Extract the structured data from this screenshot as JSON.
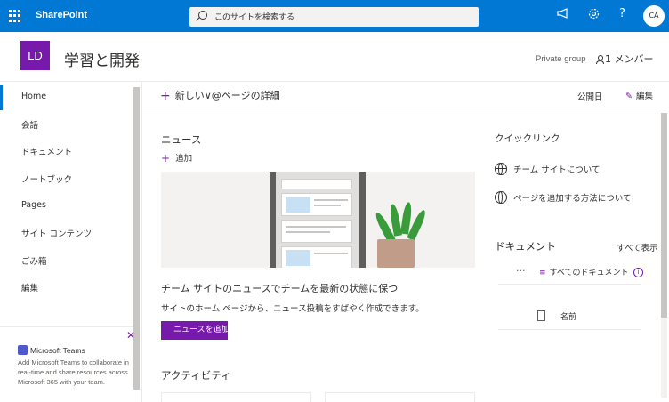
{
  "suitebar": {
    "brand": "SharePoint",
    "search_placeholder": "このサイトを検索する",
    "avatar_initials": "CA",
    "help_glyph": "?",
    "icons": [
      "megaphone-icon",
      "gear-icon",
      "help-icon"
    ],
    "color": "#0078d4"
  },
  "site": {
    "logo": "LD",
    "logo_color": "#7719aa",
    "title": "学習と開発",
    "privacy": "Private group",
    "members": "1 メンバー"
  },
  "nav": {
    "items": [
      {
        "label": "Home"
      },
      {
        "label": "会話"
      },
      {
        "label": "ドキュメント"
      },
      {
        "label": "ノートブック"
      },
      {
        "label": "Pages"
      },
      {
        "label": "サイト コンテンツ"
      },
      {
        "label": "ごみ箱"
      },
      {
        "label": "編集"
      }
    ],
    "active_index": 0
  },
  "teams": {
    "title": "Microsoft Teams",
    "body": "Add Microsoft Teams to collaborate in real-time and share resources across Microsoft 365 with your team."
  },
  "commandbar": {
    "new_label": "新しい∨@ページの詳細",
    "published": "公開日",
    "edit": "編集"
  },
  "news": {
    "title": "ニュース",
    "add": "追加",
    "headline": "チーム サイトのニュースでチームを最新の状態に保つ",
    "subtext": "サイトのホーム ページから、ニュース投稿をすばやく作成できます。",
    "button": "ニュースを追加する"
  },
  "activity": {
    "title": "アクティビティ"
  },
  "quicklinks": {
    "title": "クイックリンク",
    "items": [
      {
        "label": "チーム サイトについて"
      },
      {
        "label": "ページを追加する方法について"
      }
    ]
  },
  "documents": {
    "title": "ドキュメント",
    "see_all": "すべて表示",
    "view": "すべてのドキュメント",
    "more": "···",
    "column_name": "名前"
  }
}
